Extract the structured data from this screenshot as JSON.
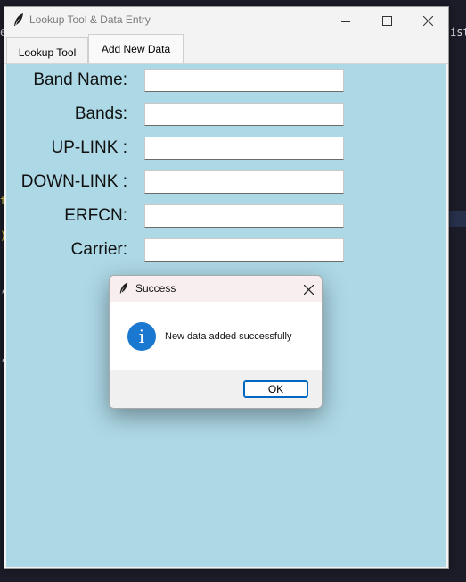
{
  "window": {
    "title": "Lookup Tool & Data Entry"
  },
  "tabs": [
    {
      "label": "Lookup Tool"
    },
    {
      "label": "Add New Data"
    }
  ],
  "form": {
    "fields": [
      {
        "label": "Band Name:",
        "value": ""
      },
      {
        "label": "Bands:",
        "value": ""
      },
      {
        "label": "UP-LINK :",
        "value": ""
      },
      {
        "label": "DOWN-LINK :",
        "value": ""
      },
      {
        "label": "ERFCN:",
        "value": ""
      },
      {
        "label": "Carrier:",
        "value": ""
      }
    ]
  },
  "dialog": {
    "title": "Success",
    "message": "New data added successfully",
    "ok_label": "OK",
    "icon": "info-icon"
  },
  "background": {
    "fragment_right": "ist",
    "fragment_left_top": "e"
  },
  "colors": {
    "content_background": "#add8e6",
    "dialog_accent": "#1b78d0",
    "ok_border": "#0067c0"
  }
}
